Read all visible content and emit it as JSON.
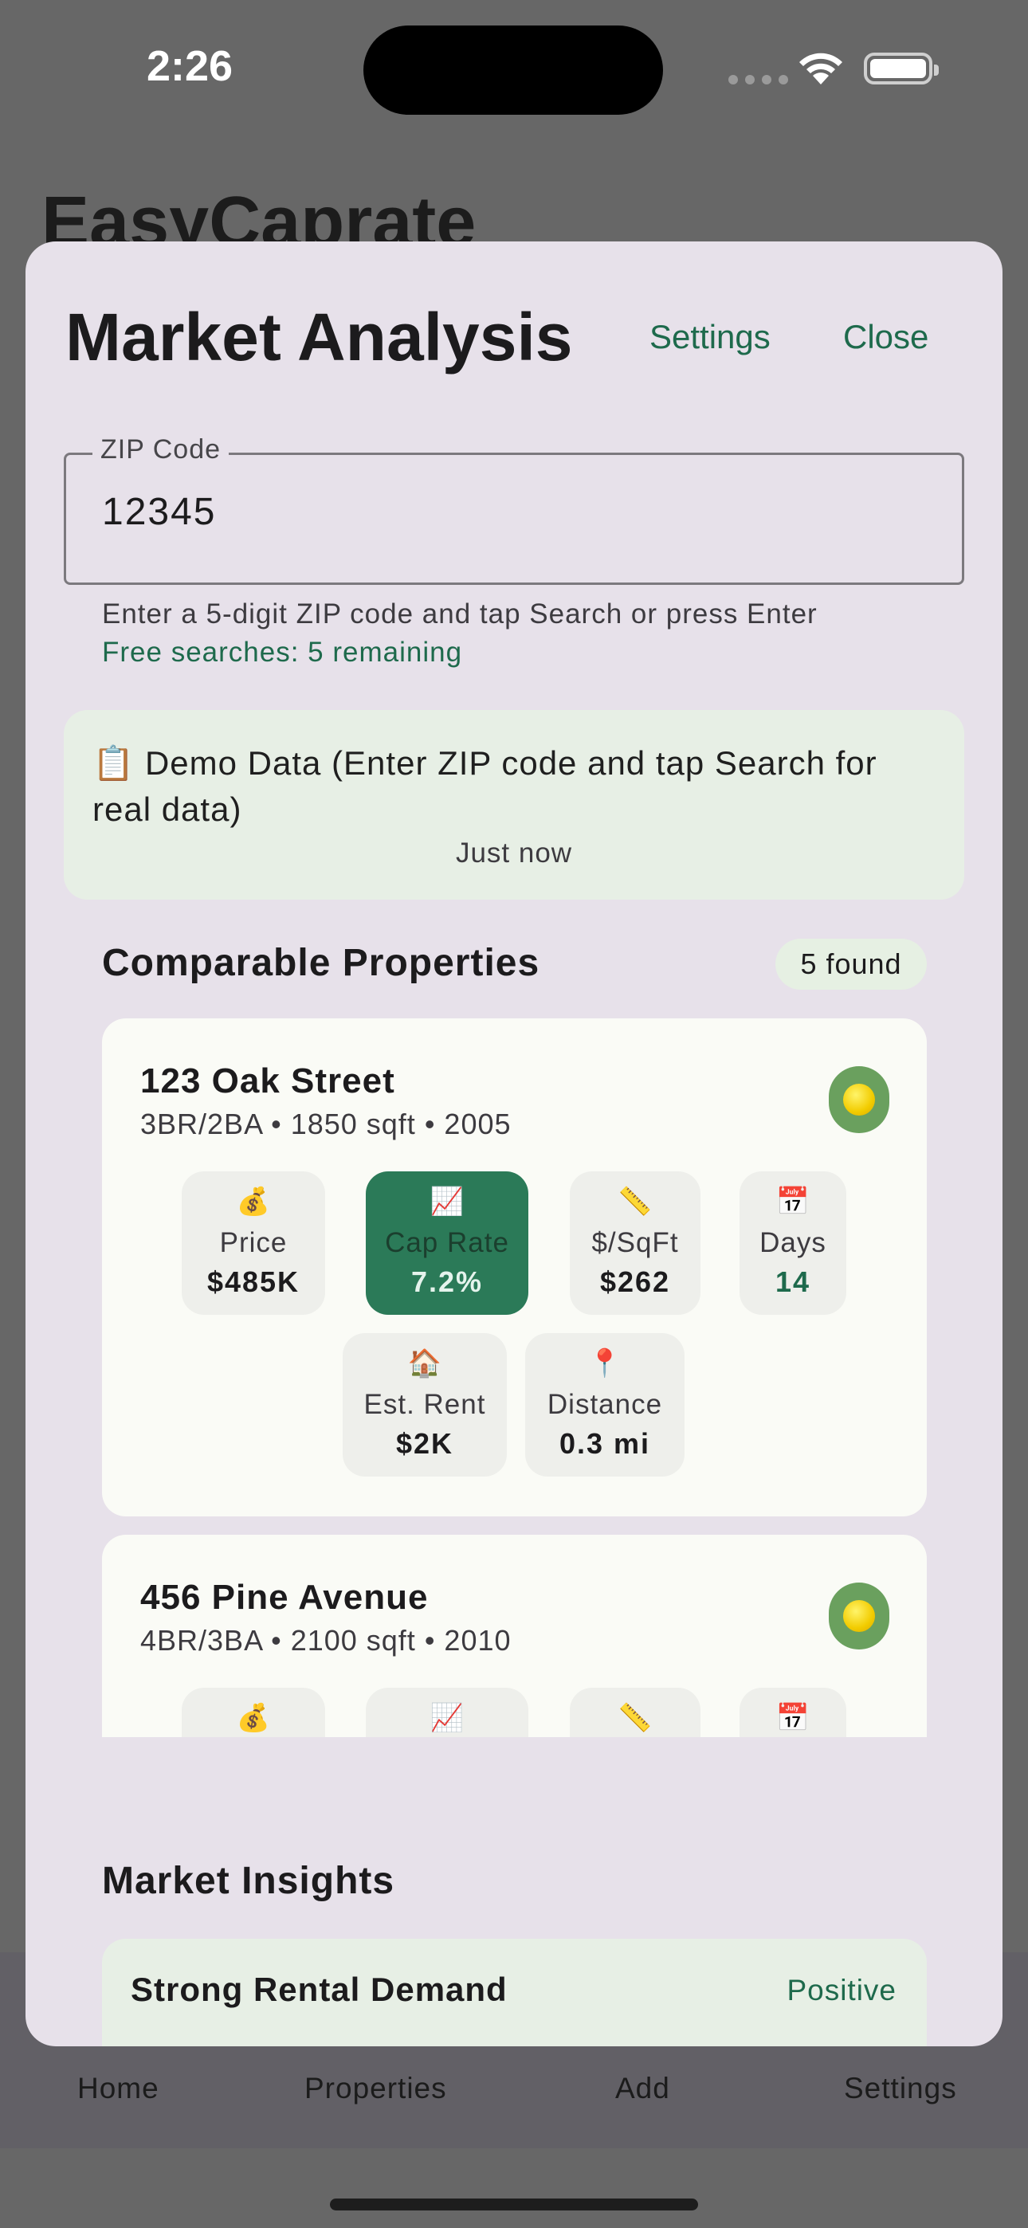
{
  "status_bar": {
    "time": "2:26"
  },
  "background": {
    "app_title": "EasyCaprate",
    "tabs": [
      "Home",
      "Properties",
      "Add",
      "Settings"
    ]
  },
  "sheet": {
    "title": "Market Analysis",
    "settings_label": "Settings",
    "close_label": "Close",
    "zip": {
      "label": "ZIP Code",
      "value": "12345",
      "helper": "Enter a 5-digit ZIP code and tap Search or press Enter",
      "remaining": "Free searches: 5 remaining"
    },
    "demo": {
      "text": "📋 Demo Data (Enter ZIP code and tap Search for real data)",
      "time": "Just now"
    },
    "comparables": {
      "title": "Comparable Properties",
      "count_badge": "5 found",
      "properties": [
        {
          "name": "123 Oak Street",
          "details": "3BR/2BA • 1850 sqft • 2005",
          "metrics": {
            "price": {
              "icon": "💰",
              "label": "Price",
              "value": "$485K"
            },
            "cap_rate": {
              "icon": "📈",
              "label": "Cap Rate",
              "value": "7.2%"
            },
            "price_sqft": {
              "icon": "📏",
              "label": "$/SqFt",
              "value": "$262"
            },
            "days": {
              "icon": "📅",
              "label": "Days",
              "value": "14"
            },
            "est_rent": {
              "icon": "🏠",
              "label": "Est. Rent",
              "value": "$2K"
            },
            "distance": {
              "icon": "📍",
              "label": "Distance",
              "value": "0.3 mi"
            }
          }
        },
        {
          "name": "456 Pine Avenue",
          "details": "4BR/3BA • 2100 sqft • 2010",
          "metrics": {
            "price": {
              "icon": "💰"
            },
            "cap_rate": {
              "icon": "📈"
            },
            "price_sqft": {
              "icon": "📏"
            },
            "days": {
              "icon": "📅"
            }
          }
        }
      ]
    },
    "insights": {
      "title": "Market Insights",
      "items": [
        {
          "title": "Strong Rental Demand",
          "sentiment": "Positive"
        }
      ]
    }
  },
  "colors": {
    "accent": "#1e6a4c",
    "highlight_metric": "#2b7a58",
    "status_dot": "#f2cc00",
    "sheet_bg": "#e7e1ea"
  }
}
